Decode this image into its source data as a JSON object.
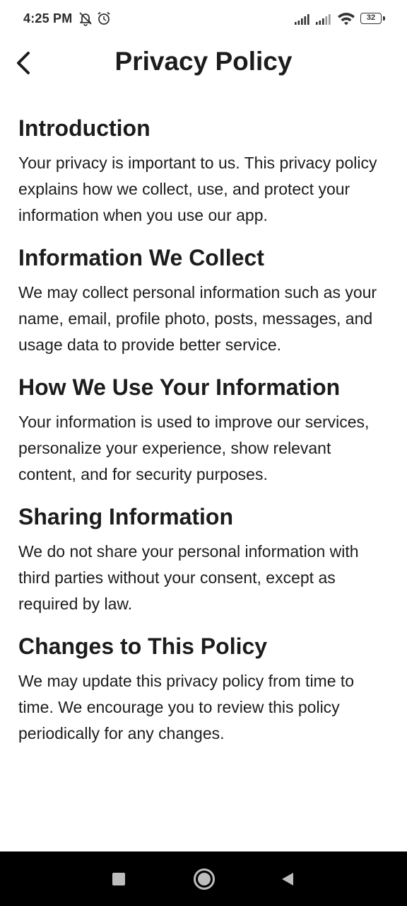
{
  "status_bar": {
    "time": "4:25 PM",
    "battery": "32",
    "icons": [
      "mute-bell-icon",
      "alarm-icon",
      "signal-icon",
      "signal-icon",
      "wifi-icon",
      "battery-icon"
    ]
  },
  "app_bar": {
    "title": "Privacy Policy",
    "back_icon": "chevron-left-icon"
  },
  "sections": [
    {
      "heading": "Introduction",
      "body": "Your privacy is important to us. This privacy policy explains how we collect, use, and protect your information when you use our app."
    },
    {
      "heading": "Information We Collect",
      "body": "We may collect personal information such as your name, email, profile photo, posts, messages, and usage data to provide better service."
    },
    {
      "heading": "How We Use Your Information",
      "body": "Your information is used to improve our services, personalize your experience, show relevant content, and for security purposes."
    },
    {
      "heading": "Sharing Information",
      "body": "We do not share your personal information with third parties without your consent, except as required by law."
    },
    {
      "heading": "Changes to This Policy",
      "body": "We may update this privacy policy from time to time. We encourage you to review this policy periodically for any changes."
    }
  ],
  "nav_bar": {
    "icons": [
      "recents-icon",
      "home-icon",
      "back-triangle-icon"
    ],
    "background": "#000000",
    "icon_color": "#bdbdbd"
  }
}
